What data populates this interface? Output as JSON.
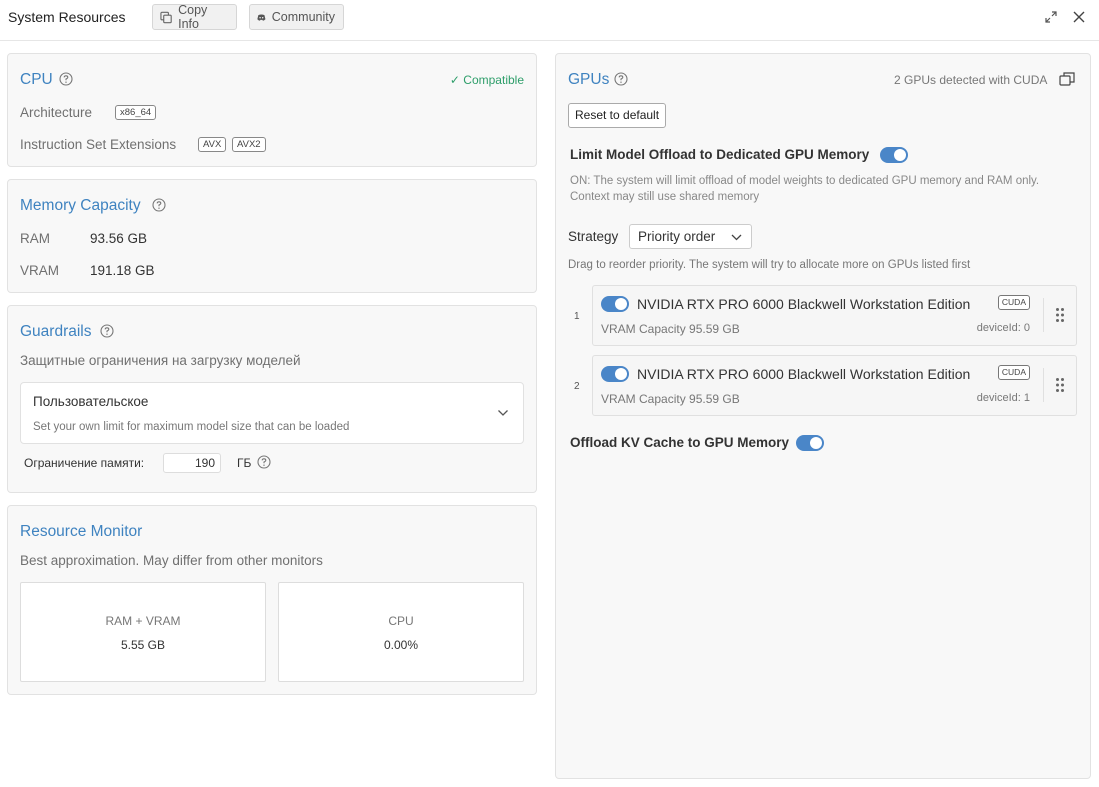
{
  "header": {
    "title": "System Resources",
    "copy_info_label": "Copy Info",
    "community_label": "Community"
  },
  "cpu": {
    "title": "CPU",
    "status": "✓ Compatible",
    "architecture_label": "Architecture",
    "architecture_value": "x86_64",
    "extensions_label": "Instruction Set Extensions",
    "extensions": [
      "AVX",
      "AVX2"
    ]
  },
  "memory": {
    "title": "Memory Capacity",
    "ram_label": "RAM",
    "ram_value": "93.56 GB",
    "vram_label": "VRAM",
    "vram_value": "191.18 GB"
  },
  "guardrails": {
    "title": "Guardrails",
    "subtitle": "Защитные ограничения на загрузку моделей",
    "selected_option": "Пользовательское",
    "option_description": "Set your own limit for maximum model size that can be loaded",
    "memory_limit_label": "Ограничение памяти:",
    "memory_limit_value": "190",
    "memory_limit_unit": "ГБ"
  },
  "monitor": {
    "title": "Resource Monitor",
    "subtitle": "Best approximation. May differ from other monitors",
    "ram_vram_label": "RAM + VRAM",
    "ram_vram_value": "5.55 GB",
    "cpu_label": "CPU",
    "cpu_value": "0.00%"
  },
  "gpus": {
    "title": "GPUs",
    "detected_text": "2 GPUs detected with CUDA",
    "reset_label": "Reset to default",
    "limit_offload_label": "Limit Model Offload to Dedicated GPU Memory",
    "limit_offload_on": true,
    "limit_offload_desc_line1": "ON: The system will limit offload of model weights to dedicated GPU memory and RAM only.",
    "limit_offload_desc_line2": "Context may still use shared memory",
    "strategy_label": "Strategy",
    "strategy_value": "Priority order",
    "reorder_hint": "Drag to reorder priority. The system will try to allocate more on GPUs listed first",
    "devices": [
      {
        "index": "1",
        "name": "NVIDIA RTX PRO 6000 Blackwell Workstation Edition",
        "backend": "CUDA",
        "vram": "VRAM Capacity 95.59 GB",
        "device_id": "deviceId: 0",
        "enabled": true
      },
      {
        "index": "2",
        "name": "NVIDIA RTX PRO 6000 Blackwell Workstation Edition",
        "backend": "CUDA",
        "vram": "VRAM Capacity 95.59 GB",
        "device_id": "deviceId: 1",
        "enabled": true
      }
    ],
    "kv_cache_label": "Offload KV Cache to GPU Memory",
    "kv_cache_on": true
  },
  "colors": {
    "accent": "#3f83c0",
    "toggle_on": "#4a86c8",
    "compatible": "#2e9e6a"
  }
}
